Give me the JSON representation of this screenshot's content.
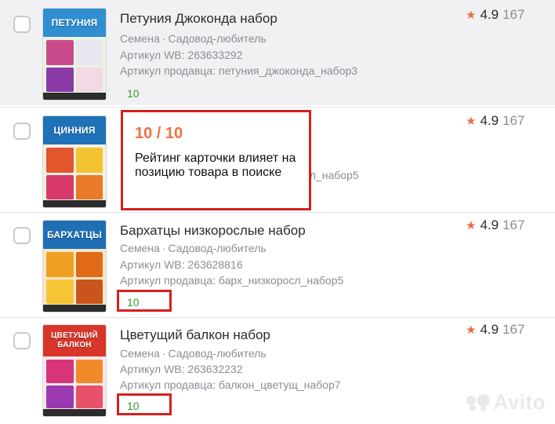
{
  "products": [
    {
      "title": "Петуния Джоконда набор",
      "category": "Семена",
      "brand": "Садовод-любитель",
      "article_wb": "Артикул WB: 263633292",
      "article_seller": "Артикул продавца: петуния_джоконда_набор3",
      "score": "10",
      "rating": "4.9",
      "reviews": "167",
      "thumb_label": "ПЕТУНИЯ",
      "thumb_color": "#2f8fd0"
    },
    {
      "title": "",
      "category": "",
      "brand": "",
      "article_wb": "",
      "article_seller": "осл_набор5",
      "score": "",
      "rating": "4.9",
      "reviews": "167",
      "thumb_label": "ЦИННИЯ",
      "thumb_color": "#1f72b8"
    },
    {
      "title": "Бархатцы низкорослые набор",
      "category": "Семена",
      "brand": "Садовод-любитель",
      "article_wb": "Артикул WB: 263628816",
      "article_seller": "Артикул продавца: барх_низкоросл_набор5",
      "score": "10",
      "rating": "4.9",
      "reviews": "167",
      "thumb_label": "БАРХАТЦЫ",
      "thumb_color": "#1f6fb5"
    },
    {
      "title": "Цветущий балкон набор",
      "category": "Семена",
      "brand": "Садовод-любитель",
      "article_wb": "Артикул WB: 263632232",
      "article_seller": "Артикул продавца: балкон_цветущ_набор7",
      "score": "10",
      "rating": "4.9",
      "reviews": "167",
      "thumb_label": "ЦВЕТУЩИЙ БАЛКОН",
      "thumb_color": "#d9362b"
    }
  ],
  "tooltip": {
    "score": "10 / 10",
    "text": "Рейтинг карточки влияет на позицию товара в поиске"
  },
  "watermark": "Avito",
  "colors": {
    "highlight_border": "#d42020",
    "score_green": "#3a9a35",
    "star": "#f06a45",
    "tooltip_score": "#f07040",
    "row_highlight_bg": "#f1f1f3"
  }
}
